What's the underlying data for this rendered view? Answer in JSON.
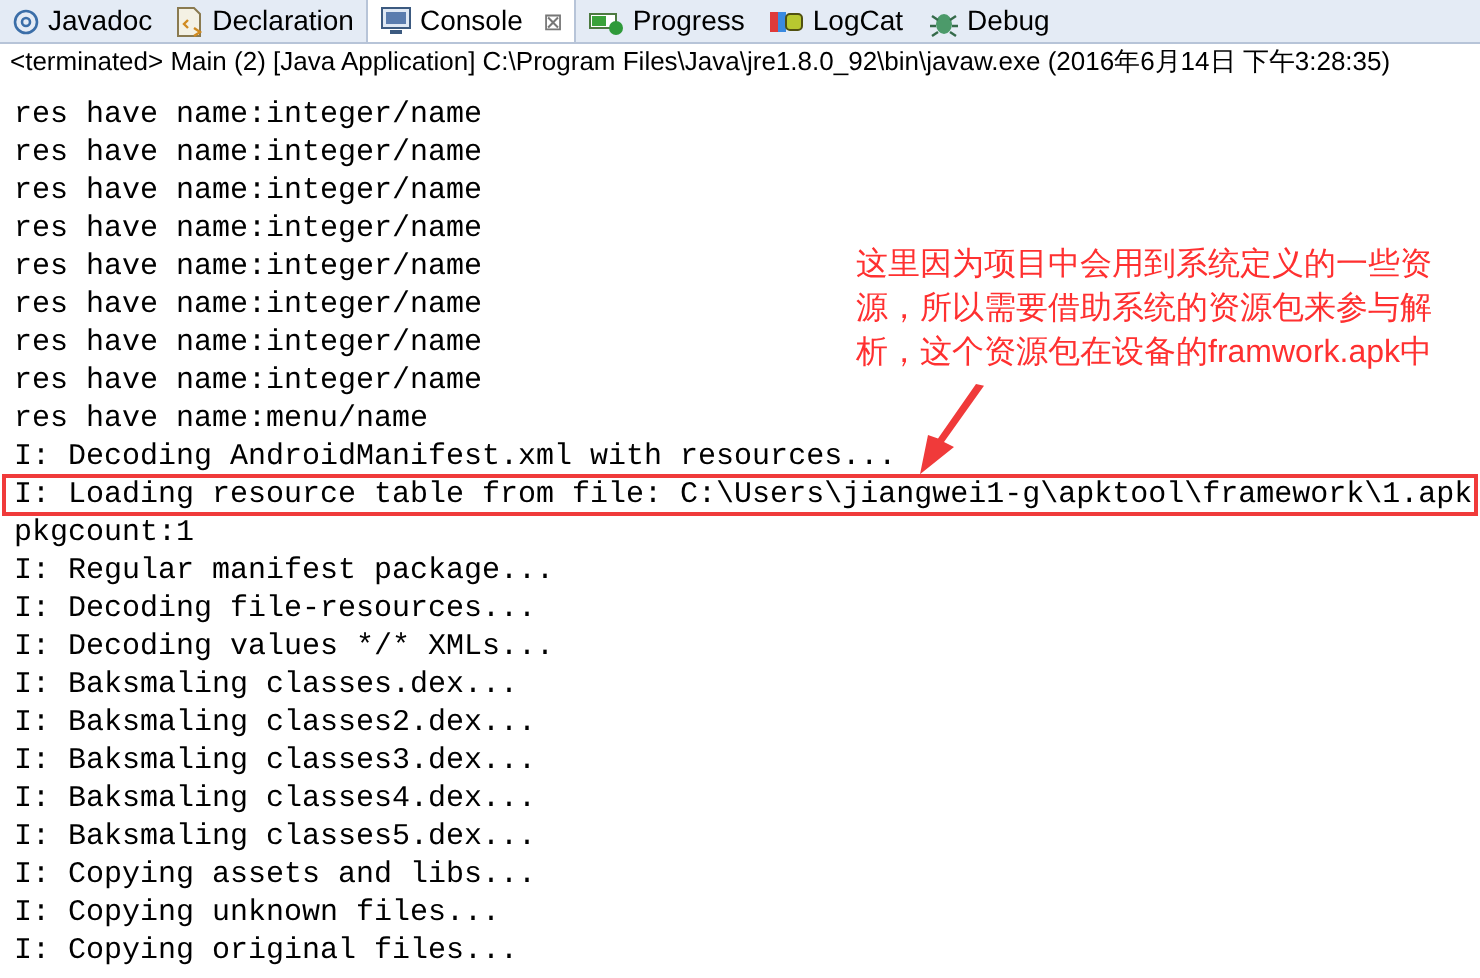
{
  "tabs": [
    {
      "label": "Javadoc",
      "selected": false
    },
    {
      "label": "Declaration",
      "selected": false
    },
    {
      "label": "Console",
      "selected": true,
      "close": "⊠"
    },
    {
      "label": "Progress",
      "selected": false
    },
    {
      "label": "LogCat",
      "selected": false
    },
    {
      "label": "Debug",
      "selected": false
    }
  ],
  "status": "<terminated> Main (2) [Java Application] C:\\Program Files\\Java\\jre1.8.0_92\\bin\\javaw.exe (2016年6月14日 下午3:28:35)",
  "console_lines": [
    {
      "text": "res have name:integer/name",
      "highlighted": false
    },
    {
      "text": "res have name:integer/name",
      "highlighted": false
    },
    {
      "text": "res have name:integer/name",
      "highlighted": false
    },
    {
      "text": "res have name:integer/name",
      "highlighted": false
    },
    {
      "text": "res have name:integer/name",
      "highlighted": false
    },
    {
      "text": "res have name:integer/name",
      "highlighted": false
    },
    {
      "text": "res have name:integer/name",
      "highlighted": false
    },
    {
      "text": "res have name:integer/name",
      "highlighted": false
    },
    {
      "text": "res have name:menu/name",
      "highlighted": false
    },
    {
      "text": "I: Decoding AndroidManifest.xml with resources...",
      "highlighted": false
    },
    {
      "text": "I: Loading resource table from file: C:\\Users\\jiangwei1-g\\apktool\\framework\\1.apk",
      "highlighted": true
    },
    {
      "text": "pkgcount:1",
      "highlighted": false
    },
    {
      "text": "I: Regular manifest package...",
      "highlighted": false
    },
    {
      "text": "I: Decoding file-resources...",
      "highlighted": false
    },
    {
      "text": "I: Decoding values */* XMLs...",
      "highlighted": false
    },
    {
      "text": "I: Baksmaling classes.dex...",
      "highlighted": false
    },
    {
      "text": "I: Baksmaling classes2.dex...",
      "highlighted": false
    },
    {
      "text": "I: Baksmaling classes3.dex...",
      "highlighted": false
    },
    {
      "text": "I: Baksmaling classes4.dex...",
      "highlighted": false
    },
    {
      "text": "I: Baksmaling classes5.dex...",
      "highlighted": false
    },
    {
      "text": "I: Copying assets and libs...",
      "highlighted": false
    },
    {
      "text": "I: Copying unknown files...",
      "highlighted": false
    },
    {
      "text": "I: Copying original files...",
      "highlighted": false
    }
  ],
  "annotation": "这里因为项目中会用到系统定义的一些资源，所以需要借助系统的资源包来参与解析，这个资源包在设备的framwork.apk中"
}
